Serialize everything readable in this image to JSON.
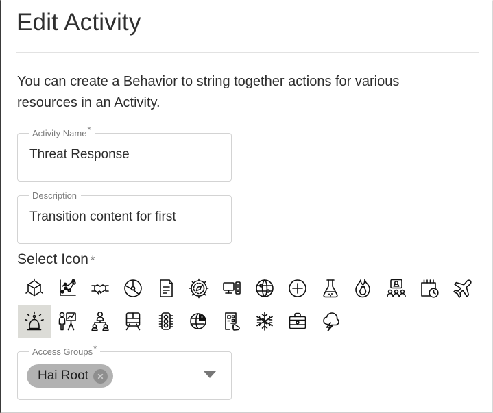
{
  "header": {
    "title": "Edit Activity"
  },
  "intro": {
    "text": "You can create a Behavior to string together actions for various resources in an Activity."
  },
  "form": {
    "activity_name": {
      "label": "Activity Name",
      "required_marker": "*",
      "value": "Threat Response",
      "placeholder": ""
    },
    "description": {
      "label": "Description",
      "required_marker": "",
      "value": "Transition content for first",
      "placeholder": ""
    },
    "access_groups": {
      "label": "Access Groups",
      "required_marker": "*",
      "chips": [
        {
          "label": "Hai Root",
          "remove_icon": "close-icon"
        }
      ],
      "dropdown_icon": "chevron-down-icon"
    }
  },
  "select_icon": {
    "heading": "Select Icon",
    "required_marker": "*",
    "selected_index": 14,
    "selected_color": "#dcdcd7",
    "icons": [
      {
        "name": "cube-icon"
      },
      {
        "name": "line-chart-icon"
      },
      {
        "name": "handshake-icon"
      },
      {
        "name": "pie-chart-circle-icon"
      },
      {
        "name": "document-icon"
      },
      {
        "name": "compass-icon"
      },
      {
        "name": "desktop-computer-icon"
      },
      {
        "name": "globe-icon"
      },
      {
        "name": "plus-circle-icon"
      },
      {
        "name": "flask-icon"
      },
      {
        "name": "fire-icon"
      },
      {
        "name": "video-conference-icon"
      },
      {
        "name": "calendar-clock-icon"
      },
      {
        "name": "airplane-icon"
      },
      {
        "name": "siren-alarm-icon"
      },
      {
        "name": "presenter-person-icon"
      },
      {
        "name": "org-chart-people-icon"
      },
      {
        "name": "train-icon"
      },
      {
        "name": "traffic-light-icon"
      },
      {
        "name": "globe-pie-icon"
      },
      {
        "name": "touch-panel-icon"
      },
      {
        "name": "snowflake-icon"
      },
      {
        "name": "briefcase-icon"
      },
      {
        "name": "storm-cloud-icon"
      }
    ]
  },
  "colors": {
    "text_primary": "#2d2d2d",
    "label_gray": "#7a7a7a",
    "field_border": "#d3d3d3",
    "divider": "#e2e2e2",
    "chip_bg": "#b2b2b2",
    "chip_remove_bg": "#8e8e8e",
    "icon_stroke": "#111111"
  }
}
